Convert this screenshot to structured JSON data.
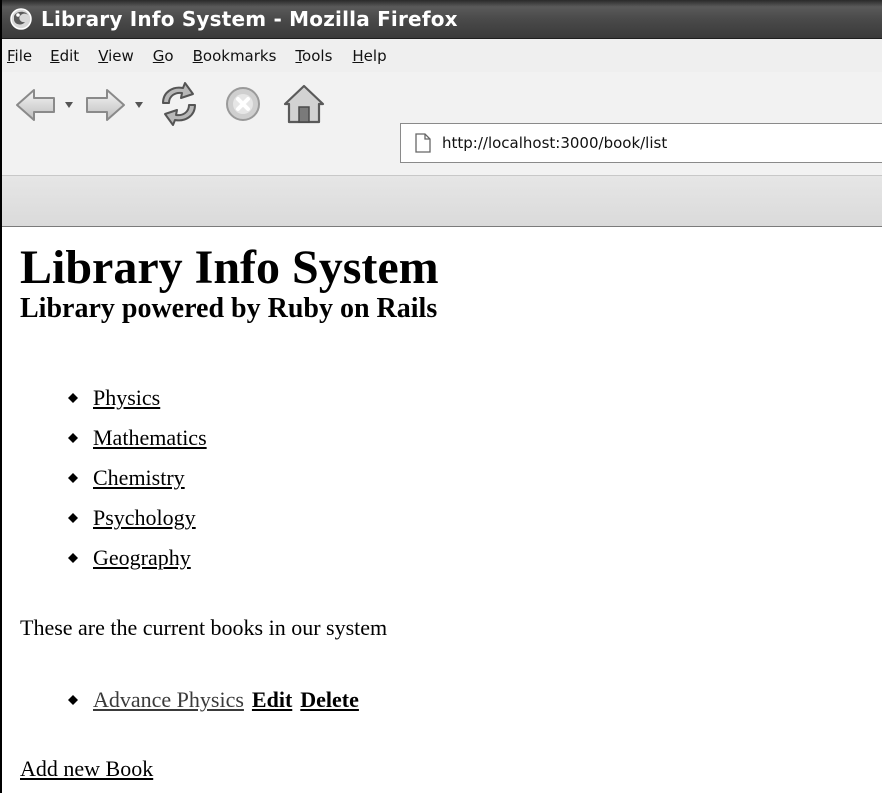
{
  "window": {
    "title": "Library Info System - Mozilla Firefox",
    "app_icon": "firefox-icon"
  },
  "menubar": {
    "items": [
      {
        "mnemonic": "F",
        "rest": "ile"
      },
      {
        "mnemonic": "E",
        "rest": "dit"
      },
      {
        "mnemonic": "V",
        "rest": "iew"
      },
      {
        "mnemonic": "G",
        "rest": "o"
      },
      {
        "mnemonic": "B",
        "rest": "ookmarks"
      },
      {
        "mnemonic": "T",
        "rest": "ools"
      },
      {
        "mnemonic": "H",
        "rest": "elp"
      }
    ]
  },
  "toolbar": {
    "icons": [
      "back-icon",
      "forward-icon",
      "reload-icon",
      "stop-icon",
      "home-icon"
    ],
    "address": {
      "url": "http://localhost:3000/book/list",
      "icon": "page-icon"
    }
  },
  "page": {
    "title": "Library Info System",
    "subtitle": "Library powered by Ruby on Rails",
    "subjects": [
      "Physics",
      "Mathematics",
      "Chemistry",
      "Psychology",
      "Geography"
    ],
    "intro": "These are the current books in our system",
    "books": [
      {
        "title": "Advance Physics",
        "edit_label": "Edit",
        "delete_label": "Delete"
      }
    ],
    "add_link": "Add new Book"
  }
}
